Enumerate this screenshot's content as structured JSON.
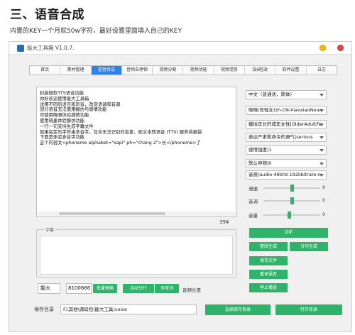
{
  "article": {
    "title": "三、语音合成",
    "description": "内置的KEY一个月就50w字符，最好设置里面填入自己的KEY"
  },
  "window": {
    "title": "能大工具箱 V1.0.7.",
    "colors": {
      "accent": "#2f80ed",
      "button": "#2fb36b",
      "close": "#e04848",
      "minimize": "#f5b700"
    }
  },
  "tabs": [
    {
      "label": "首页"
    },
    {
      "label": "素材管理"
    },
    {
      "label": "语音合成",
      "active": true
    },
    {
      "label": "音频去停顿"
    },
    {
      "label": "视频分割"
    },
    {
      "label": "视频功能"
    },
    {
      "label": "视频混剪"
    },
    {
      "label": "加6腔改"
    },
    {
      "label": "软件设置"
    },
    {
      "label": "日志"
    }
  ],
  "editor": {
    "lines": [
      "封装微软TTS语音功能",
      "你好欢迎使用能大工具箱",
      "试用不同的语言和声音，改变语调和音调",
      "部分语音无法使用模仿与感情功能",
      "可使用晓晓体验感情功能",
      "使用晓墨体验模仿功能",
      "一行一句支持生成字幕文件",
      "如果指定的字符串多音字，包含无法识别的音素，则文本转语音 (TTS) 服务将报错",
      "下面是体验多音字功能",
      "这个内容太<phoneme alphabet=\"sapi\" ph=\"chang 2\">长</phoneme>了"
    ],
    "char_count": "394"
  },
  "subtitle": {
    "label": "字幕",
    "value": ""
  },
  "bottom": {
    "short_value": "能大",
    "number_value": "8100666",
    "batch_label": "批量替换",
    "auto_label": "自动分行",
    "multi_label": "多音词",
    "audio_length_label": "音频长度",
    "save_dir_label": "保存目录",
    "save_dir_value": "F:\\其他\\源码包\\能大工具\\voice",
    "choose_dir_label": "选择保存目录",
    "open_dir_label": "打开目录"
  },
  "right_panel": {
    "language": "中文（普通话，简体）",
    "voice": "晓晓(年轻女)zh-CN-XiaoxiaoNeural",
    "role": "模拟年长的成年女性|OlderAdultFemale",
    "style": "表达严肃和命令的语气|serious",
    "intensity": "感情强度|1",
    "pause": "默认停顿|0",
    "audio_format": "音质|audio-48khz-192kbitrate-mono-mp3",
    "sliders": [
      {
        "label": "语速",
        "value": "0",
        "level": 0.5
      },
      {
        "label": "音调",
        "value": "0",
        "level": 0.5
      },
      {
        "label": "音量",
        "value": "0",
        "level": 0.45
      }
    ],
    "listen_label": "试听",
    "split_gen_label": "整段生成",
    "split_synth_label": "分句生成",
    "save_file_label": "保存文件",
    "rerecord_label": "重录语音",
    "stop_label": "停止播放"
  }
}
